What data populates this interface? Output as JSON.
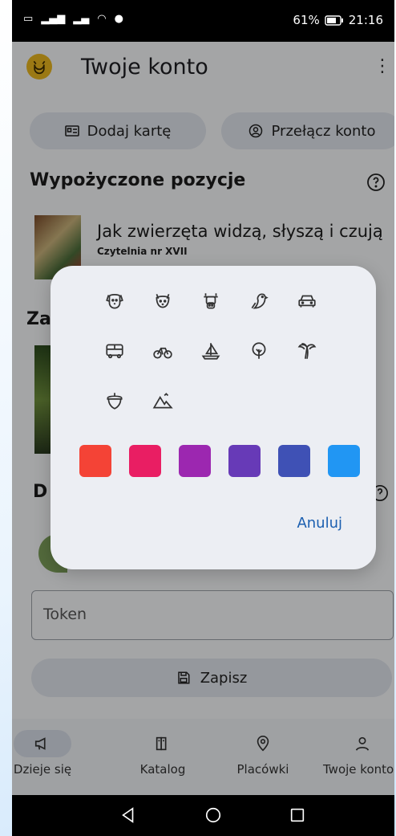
{
  "status_bar": {
    "left_icons": [
      "volte-icon",
      "signal-icon",
      "signal-roaming-icon",
      "wifi-icon",
      "messenger-icon"
    ],
    "battery": "61%",
    "time": "21:16"
  },
  "app_bar": {
    "title": "Twoje konto"
  },
  "actions": {
    "add_card": "Dodaj kartę",
    "switch_account": "Przełącz konto"
  },
  "borrowed": {
    "title": "Wypożyczone pozycje",
    "items": [
      {
        "title": "Jak zwierzęta widzą, słyszą i czują",
        "location": "Czytelnia nr XVII"
      }
    ]
  },
  "partial": {
    "za": "Za",
    "d": "D"
  },
  "token": {
    "placeholder": "Token"
  },
  "save": {
    "label": "Zapisz"
  },
  "bottom_nav": [
    {
      "label": "Dzieje się",
      "icon": "megaphone-icon"
    },
    {
      "label": "Katalog",
      "icon": "books-icon"
    },
    {
      "label": "Placówki",
      "icon": "location-pin-icon"
    },
    {
      "label": "Twoje konto",
      "icon": "user-icon"
    }
  ],
  "dialog": {
    "icons": [
      "dog-icon",
      "cat-icon",
      "cow-icon",
      "bird-icon",
      "car-icon",
      "bus-icon",
      "bicycle-icon",
      "sailboat-icon",
      "tree-icon",
      "palm-tree-icon",
      "acorn-icon",
      "mountains-icon"
    ],
    "colors": [
      "#f44336",
      "#e91e63",
      "#9c27b0",
      "#673ab7",
      "#3f51b5",
      "#2196f3"
    ],
    "cancel": "Anuluj"
  },
  "theme": {
    "accent": "#1b5fb0",
    "avatar": "#e8b51e"
  }
}
